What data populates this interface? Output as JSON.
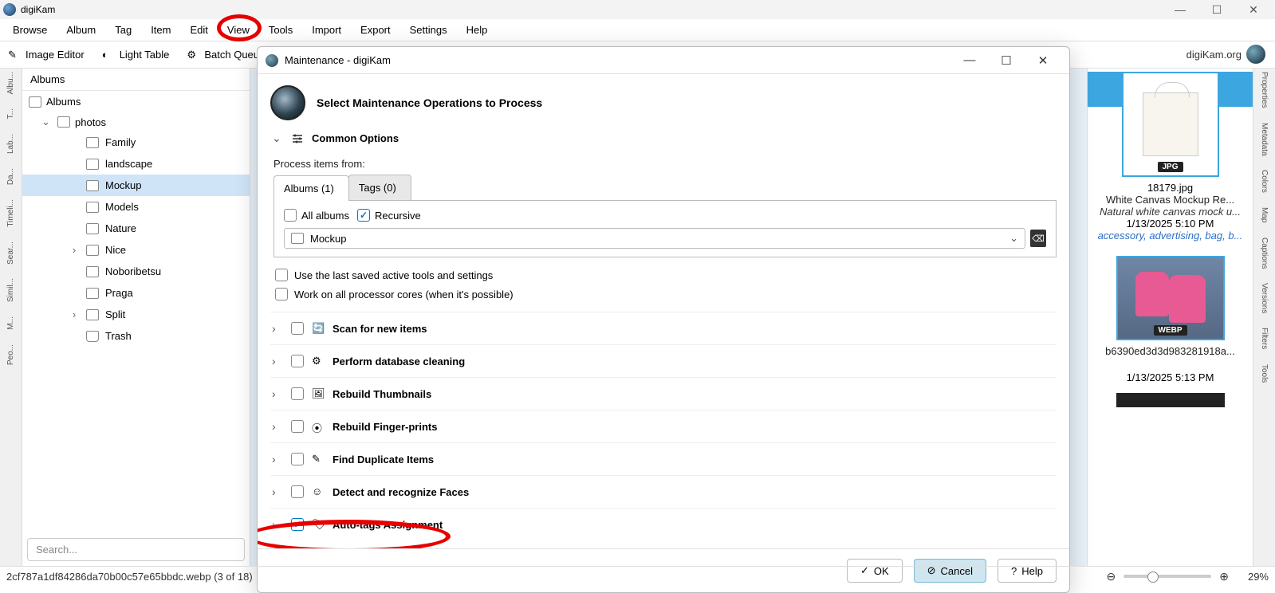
{
  "titleBar": {
    "title": "digiKam"
  },
  "menuBar": {
    "items": [
      "Browse",
      "Album",
      "Tag",
      "Item",
      "Edit",
      "View",
      "Tools",
      "Import",
      "Export",
      "Settings",
      "Help"
    ]
  },
  "toolBar": {
    "items": [
      {
        "label": "Image Editor"
      },
      {
        "label": "Light Table"
      },
      {
        "label": "Batch Queue"
      }
    ],
    "brand": "digiKam.org"
  },
  "leftRail": [
    "Albu...",
    "T...",
    "Lab...",
    "Da...",
    "Timeli...",
    "Sear...",
    "Simil...",
    "M...",
    "Peo..."
  ],
  "rightRail": [
    "Properties",
    "Metadata",
    "Colors",
    "Map",
    "Captions",
    "Versions",
    "Filters",
    "Tools"
  ],
  "sidebar": {
    "header": "Albums",
    "root": "Albums",
    "photos": "photos",
    "items": [
      {
        "label": "Family",
        "selected": false,
        "children": false
      },
      {
        "label": "landscape",
        "selected": false,
        "children": false
      },
      {
        "label": "Mockup",
        "selected": true,
        "children": false
      },
      {
        "label": "Models",
        "selected": false,
        "children": false
      },
      {
        "label": "Nature",
        "selected": false,
        "children": false
      },
      {
        "label": "Nice",
        "selected": false,
        "children": true
      },
      {
        "label": "Noboribetsu",
        "selected": false,
        "children": false
      },
      {
        "label": "Praga",
        "selected": false,
        "children": false
      },
      {
        "label": "Split",
        "selected": false,
        "children": true
      },
      {
        "label": "Trash",
        "selected": false,
        "children": false,
        "trash": true
      }
    ],
    "searchPlaceholder": "Search..."
  },
  "dialog": {
    "title": "Maintenance - digiKam",
    "heading": "Select Maintenance Operations to Process",
    "common": {
      "label": "Common Options",
      "processLabel": "Process items from:",
      "tabs": {
        "albums": "Albums (1)",
        "tags": "Tags (0)"
      },
      "allAlbums": "All albums",
      "recursive": "Recursive",
      "selectedAlbum": "Mockup",
      "opt1": "Use the last saved active tools and settings",
      "opt2": "Work on all processor cores (when it's possible)"
    },
    "ops": [
      {
        "label": "Scan for new items",
        "checked": false
      },
      {
        "label": "Perform database cleaning",
        "checked": false
      },
      {
        "label": "Rebuild Thumbnails",
        "checked": false
      },
      {
        "label": "Rebuild Finger-prints",
        "checked": false
      },
      {
        "label": "Find Duplicate Items",
        "checked": false
      },
      {
        "label": "Detect and recognize Faces",
        "checked": false
      },
      {
        "label": "Auto-tags Assignment",
        "checked": true
      }
    ],
    "buttons": {
      "ok": "OK",
      "cancel": "Cancel",
      "help": "Help"
    }
  },
  "preview": {
    "item1": {
      "badge": "JPG",
      "filename": "18179.jpg",
      "desc": "White Canvas Mockup Re...",
      "desc2": "Natural white canvas mock u...",
      "date": "1/13/2025 5:10 PM",
      "tags": "accessory, advertising, bag, b..."
    },
    "item2": {
      "badge": "WEBP",
      "filename": "b6390ed3d3d983281918a...",
      "date": "1/13/2025 5:13 PM"
    }
  },
  "statusBar": {
    "left": "2cf787a1df84286da70b00c57e65bbdc.webp (3 of 18)",
    "zoom": "29%"
  }
}
